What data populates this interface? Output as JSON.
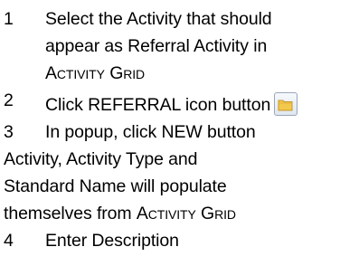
{
  "steps": [
    {
      "number": "1",
      "line1": "Select the Activity that should",
      "line2": "appear as Referral Activity in",
      "line3_sc": "Activity Grid"
    },
    {
      "number": "2",
      "text": "Click REFERRAL icon button",
      "icon": "referral-folder-icon"
    },
    {
      "number": "3",
      "text": "In popup, click NEW button"
    },
    {
      "number": "4",
      "text": "Enter Description"
    }
  ],
  "note": {
    "line1": "Activity, Activity Type and",
    "line2": "Standard Name will populate",
    "line3_prefix": "themselves from ",
    "line3_sc": "Activity Grid"
  },
  "colors": {
    "text": "#000000",
    "icon_border": "#9aa7b8",
    "folder": "#f2c94c"
  }
}
